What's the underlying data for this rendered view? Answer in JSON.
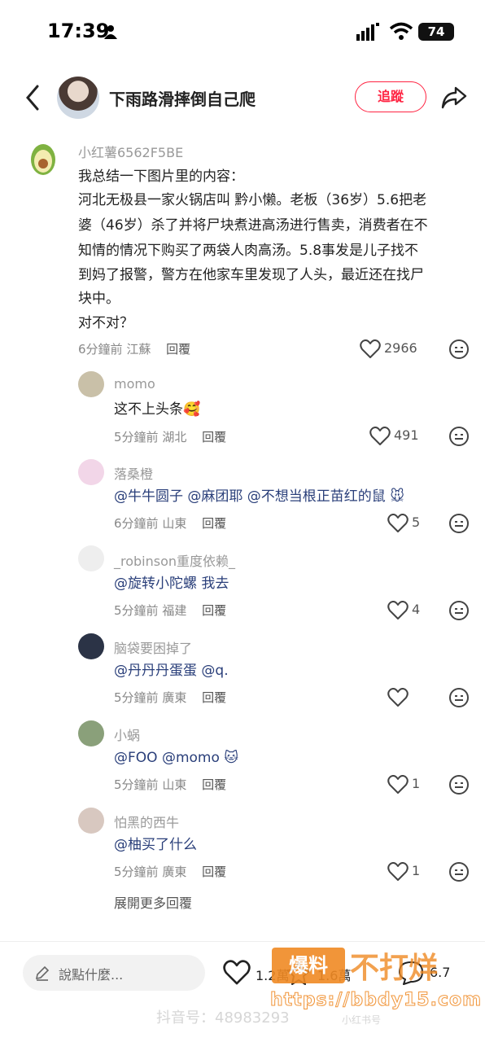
{
  "status_bar": {
    "time": "17:39",
    "battery": "74"
  },
  "header": {
    "title": "下雨路滑摔倒自己爬",
    "follow_label": "追蹤"
  },
  "main_comment": {
    "username": "小红薯6562F5BE",
    "lines": [
      "我总结一下图片里的内容：",
      "河北无极县一家火锅店叫 黔小懒。老板（36岁）5.6把老",
      "婆（46岁）杀了并将尸块煮进高汤进行售卖，消费者在不",
      "知情的情况下购买了两袋人肉高汤。5.8事发是儿子找不",
      "到妈了报警，警方在他家车里发现了人头，最近还在找尸",
      "块中。",
      "对不对？"
    ],
    "time": "6分鐘前",
    "location": "江蘇",
    "reply_label": "回覆",
    "likes": "2966"
  },
  "replies": [
    {
      "username": "momo",
      "text": "这不上头条🥰",
      "time": "5分鐘前",
      "location": "湖北",
      "reply_label": "回覆",
      "likes": "491",
      "avatar_color": "#c9c0a8"
    },
    {
      "username": "落桑橙",
      "text": "@牛牛圆子 @麻团耶 @不想当根正苗红的鼠 🐭",
      "time": "6分鐘前",
      "location": "山東",
      "reply_label": "回覆",
      "likes": "5",
      "avatar_color": "#f2d6e8"
    },
    {
      "username": "_robinson重度依赖_",
      "text": "@旋转小陀螺 我去",
      "time": "5分鐘前",
      "location": "福建",
      "reply_label": "回覆",
      "likes": "4",
      "avatar_color": "#eeeeee"
    },
    {
      "username": "脑袋要困掉了",
      "text": "@丹丹丹蛋蛋 @q.",
      "time": "5分鐘前",
      "location": "廣東",
      "reply_label": "回覆",
      "likes": "",
      "avatar_color": "#2b3346"
    },
    {
      "username": "小蜗",
      "text": "@FOO @momo 🐱",
      "time": "5分鐘前",
      "location": "山東",
      "reply_label": "回覆",
      "likes": "1",
      "avatar_color": "#8aa07a"
    },
    {
      "username": "怕黑的西牛",
      "text": "@柚买了什么",
      "time": "5分鐘前",
      "location": "廣東",
      "reply_label": "回覆",
      "likes": "1",
      "avatar_color": "#d8c8c0"
    }
  ],
  "more_replies_label": "展開更多回覆",
  "bottom_bar": {
    "input_placeholder": "說點什麼...",
    "like_count": "1.2萬",
    "fav_count": "1.6萬",
    "comment_count": "6.7"
  },
  "watermarks": {
    "logo_text": "爆料",
    "site_name": "不打烊",
    "url": "https://bbdy15.com",
    "douyin": "抖音号：48983293",
    "small": "小红书号"
  },
  "colors": {
    "accent": "#ff2442",
    "watermark": "#f08a24"
  }
}
